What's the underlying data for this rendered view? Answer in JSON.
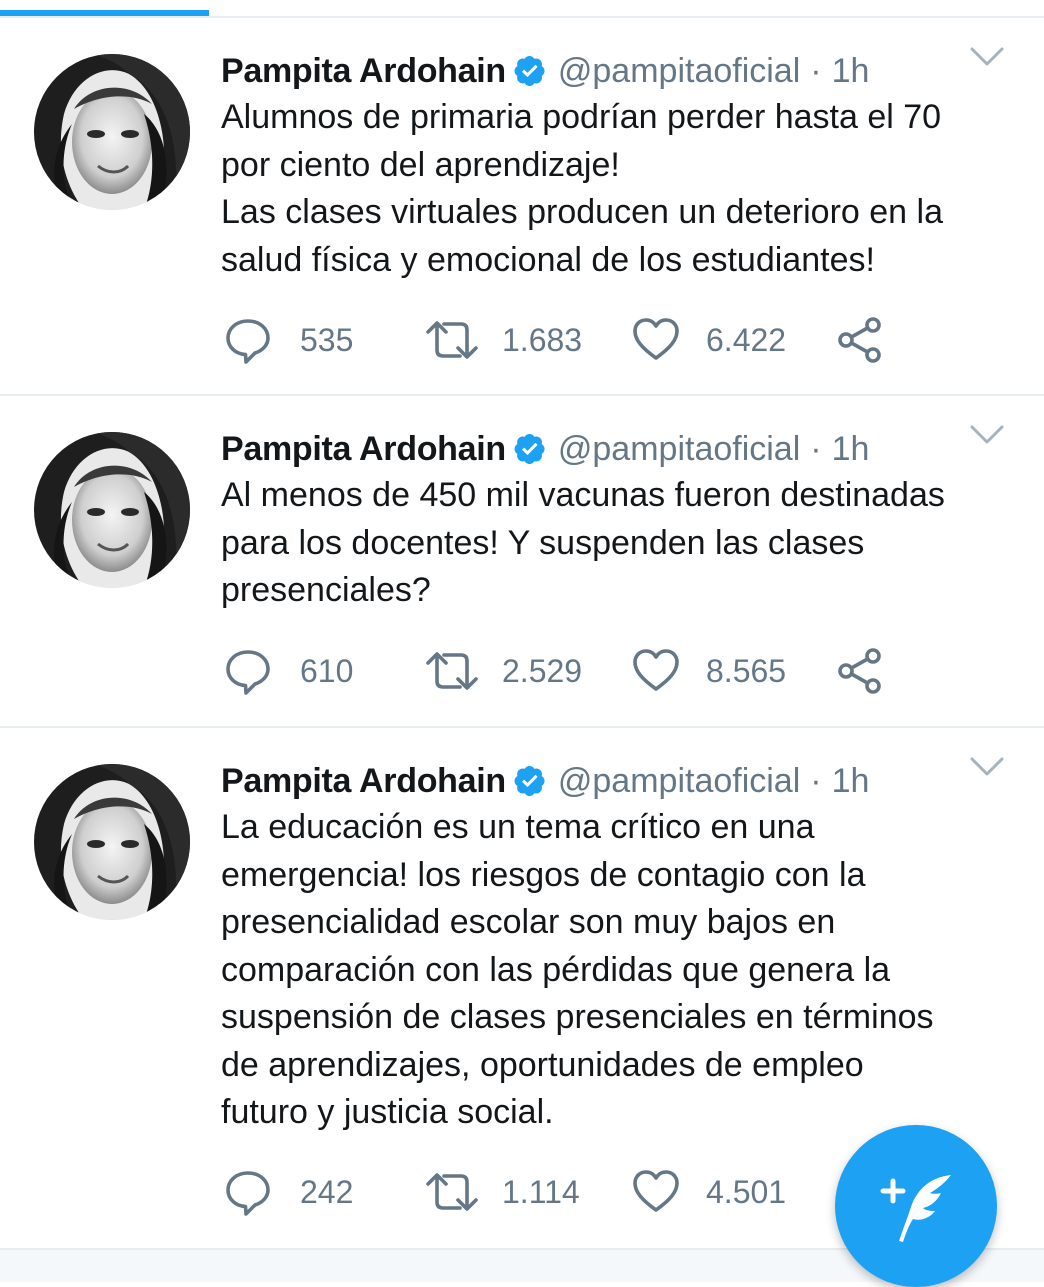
{
  "colors": {
    "accent": "#1da1f2",
    "secondary_text": "#657786",
    "divider": "#e6ecf0"
  },
  "tweets": [
    {
      "name": "Pampita Ardohain",
      "handle": "@pampitaoficial",
      "separator": "·",
      "time": "1h",
      "text": "Alumnos de primaria podrían perder hasta el 70\npor ciento del aprendizaje!\nLas clases virtuales producen un deterioro en la\nsalud física y emocional de los estudiantes!",
      "replies": "535",
      "retweets": "1.683",
      "likes": "6.422"
    },
    {
      "name": "Pampita Ardohain",
      "handle": "@pampitaoficial",
      "separator": "·",
      "time": "1h",
      "text": "Al menos de 450 mil vacunas fueron destinadas\npara los docentes! Y suspenden las clases\npresenciales?",
      "replies": "610",
      "retweets": "2.529",
      "likes": "8.565"
    },
    {
      "name": "Pampita Ardohain",
      "handle": "@pampitaoficial",
      "separator": "·",
      "time": "1h",
      "text": "La educación es un tema crítico en una\nemergencia! los riesgos de contagio con la\npresencialidad escolar son muy bajos en\ncomparación con las pérdidas que genera la\nsuspensión de clases presenciales en términos\nde aprendizajes, oportunidades de empleo\nfuturo y justicia social.",
      "replies": "242",
      "retweets": "1.114",
      "likes": "4.501"
    }
  ],
  "icons": {
    "reply": "reply-icon",
    "retweet": "retweet-icon",
    "like": "heart-icon",
    "share": "share-icon",
    "verified": "verified-badge-icon",
    "menu": "chevron-down-icon",
    "compose": "compose-tweet-icon"
  }
}
